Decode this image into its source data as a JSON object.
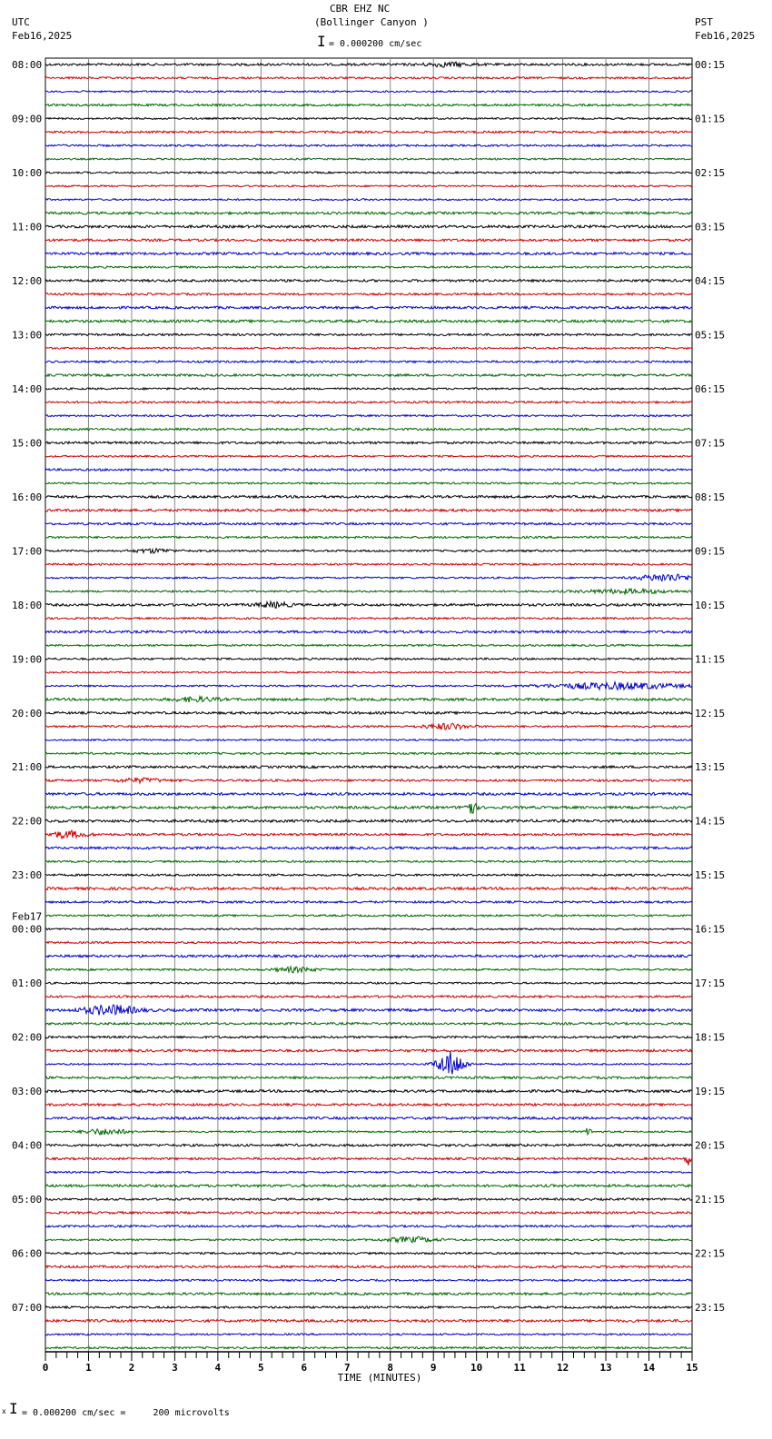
{
  "header": {
    "station": "CBR EHZ NC",
    "location": "(Bollinger Canyon )",
    "left_tz": "UTC",
    "left_date": "Feb16,2025",
    "right_tz": "PST",
    "right_date": "Feb16,2025",
    "scale": "= 0.000200 cm/sec"
  },
  "footer": {
    "scale": "= 0.000200 cm/sec =     200 microvolts"
  },
  "chart_data": {
    "type": "line",
    "title": "CBR EHZ NC (Bollinger Canyon )",
    "xlabel": "TIME (MINUTES)",
    "xlim": [
      0,
      15
    ],
    "x_ticks": [
      "0",
      "1",
      "2",
      "3",
      "4",
      "5",
      "6",
      "7",
      "8",
      "9",
      "10",
      "11",
      "12",
      "13",
      "14",
      "15"
    ],
    "trace_minutes": 15,
    "trace_count": 96,
    "colors": [
      "#000000",
      "#cc0000",
      "#0000cc",
      "#006600"
    ],
    "left_labels": [
      "08:00",
      "09:00",
      "10:00",
      "11:00",
      "12:00",
      "13:00",
      "14:00",
      "15:00",
      "16:00",
      "17:00",
      "18:00",
      "19:00",
      "20:00",
      "21:00",
      "22:00",
      "23:00",
      "00:00",
      "01:00",
      "02:00",
      "03:00",
      "04:00",
      "05:00",
      "06:00",
      "07:00"
    ],
    "date_change": {
      "row_label_index": 16,
      "text": "Feb17"
    },
    "right_labels": [
      "00:15",
      "01:15",
      "02:15",
      "03:15",
      "04:15",
      "05:15",
      "06:15",
      "07:15",
      "08:15",
      "09:15",
      "10:15",
      "11:15",
      "12:15",
      "13:15",
      "14:15",
      "15:15",
      "16:15",
      "17:15",
      "18:15",
      "19:15",
      "20:15",
      "21:15",
      "22:15",
      "23:15"
    ],
    "events": [
      {
        "row": 0,
        "minute": 9.3,
        "duration": 1.0,
        "amplitude": 2
      },
      {
        "row": 36,
        "minute": 2.5,
        "duration": 0.8,
        "amplitude": 2
      },
      {
        "row": 38,
        "minute": 14.4,
        "duration": 1.2,
        "amplitude": 4
      },
      {
        "row": 39,
        "minute": 13.5,
        "duration": 2.0,
        "amplitude": 2
      },
      {
        "row": 40,
        "minute": 5.3,
        "duration": 0.8,
        "amplitude": 2.5
      },
      {
        "row": 46,
        "minute": 13.2,
        "duration": 3.0,
        "amplitude": 3.5
      },
      {
        "row": 47,
        "minute": 3.5,
        "duration": 1.0,
        "amplitude": 2
      },
      {
        "row": 49,
        "minute": 9.3,
        "duration": 1.0,
        "amplitude": 3
      },
      {
        "row": 53,
        "minute": 2.2,
        "duration": 1.0,
        "amplitude": 2
      },
      {
        "row": 55,
        "minute": 9.85,
        "duration": 0.25,
        "amplitude": 9
      },
      {
        "row": 57,
        "minute": 0.5,
        "duration": 0.9,
        "amplitude": 3.5
      },
      {
        "row": 67,
        "minute": 5.8,
        "duration": 0.9,
        "amplitude": 2.5
      },
      {
        "row": 70,
        "minute": 1.5,
        "duration": 1.2,
        "amplitude": 5
      },
      {
        "row": 74,
        "minute": 9.4,
        "duration": 0.6,
        "amplitude": 14
      },
      {
        "row": 79,
        "minute": 1.4,
        "duration": 1.0,
        "amplitude": 3
      },
      {
        "row": 79,
        "minute": 12.6,
        "duration": 0.15,
        "amplitude": 4
      },
      {
        "row": 81,
        "minute": 14.9,
        "duration": 0.1,
        "amplitude": 8
      },
      {
        "row": 87,
        "minute": 8.5,
        "duration": 1.2,
        "amplitude": 2.5
      }
    ]
  }
}
